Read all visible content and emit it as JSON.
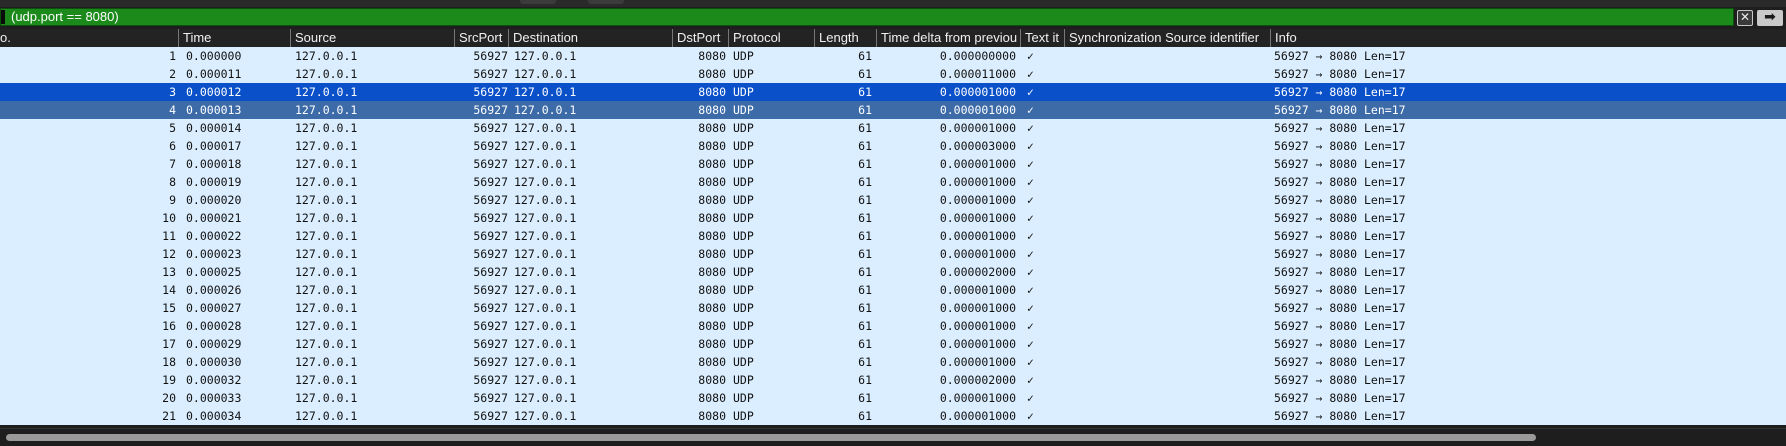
{
  "filter": {
    "value": "(udp.port == 8080)",
    "clear_icon": "✕",
    "apply_icon": "➡"
  },
  "columns": [
    "o.",
    "Time",
    "Source",
    "SrcPort",
    "Destination",
    "DstPort",
    "Protocol",
    "Length",
    "Time delta from previou",
    "Text it",
    "Synchronization Source identifier",
    "Info"
  ],
  "check": "✓",
  "selection": {
    "selected_row": 3,
    "secondary_row": 4
  },
  "rows": [
    {
      "no": "1",
      "time": "0.000000",
      "src": "127.0.0.1",
      "sport": "56927",
      "dst": "127.0.0.1",
      "dport": "8080",
      "proto": "UDP",
      "len": "61",
      "delta": "0.000000000",
      "info": "56927 → 8080 Len=17"
    },
    {
      "no": "2",
      "time": "0.000011",
      "src": "127.0.0.1",
      "sport": "56927",
      "dst": "127.0.0.1",
      "dport": "8080",
      "proto": "UDP",
      "len": "61",
      "delta": "0.000011000",
      "info": "56927 → 8080 Len=17"
    },
    {
      "no": "3",
      "time": "0.000012",
      "src": "127.0.0.1",
      "sport": "56927",
      "dst": "127.0.0.1",
      "dport": "8080",
      "proto": "UDP",
      "len": "61",
      "delta": "0.000001000",
      "info": "56927 → 8080 Len=17"
    },
    {
      "no": "4",
      "time": "0.000013",
      "src": "127.0.0.1",
      "sport": "56927",
      "dst": "127.0.0.1",
      "dport": "8080",
      "proto": "UDP",
      "len": "61",
      "delta": "0.000001000",
      "info": "56927 → 8080 Len=17"
    },
    {
      "no": "5",
      "time": "0.000014",
      "src": "127.0.0.1",
      "sport": "56927",
      "dst": "127.0.0.1",
      "dport": "8080",
      "proto": "UDP",
      "len": "61",
      "delta": "0.000001000",
      "info": "56927 → 8080 Len=17"
    },
    {
      "no": "6",
      "time": "0.000017",
      "src": "127.0.0.1",
      "sport": "56927",
      "dst": "127.0.0.1",
      "dport": "8080",
      "proto": "UDP",
      "len": "61",
      "delta": "0.000003000",
      "info": "56927 → 8080 Len=17"
    },
    {
      "no": "7",
      "time": "0.000018",
      "src": "127.0.0.1",
      "sport": "56927",
      "dst": "127.0.0.1",
      "dport": "8080",
      "proto": "UDP",
      "len": "61",
      "delta": "0.000001000",
      "info": "56927 → 8080 Len=17"
    },
    {
      "no": "8",
      "time": "0.000019",
      "src": "127.0.0.1",
      "sport": "56927",
      "dst": "127.0.0.1",
      "dport": "8080",
      "proto": "UDP",
      "len": "61",
      "delta": "0.000001000",
      "info": "56927 → 8080 Len=17"
    },
    {
      "no": "9",
      "time": "0.000020",
      "src": "127.0.0.1",
      "sport": "56927",
      "dst": "127.0.0.1",
      "dport": "8080",
      "proto": "UDP",
      "len": "61",
      "delta": "0.000001000",
      "info": "56927 → 8080 Len=17"
    },
    {
      "no": "10",
      "time": "0.000021",
      "src": "127.0.0.1",
      "sport": "56927",
      "dst": "127.0.0.1",
      "dport": "8080",
      "proto": "UDP",
      "len": "61",
      "delta": "0.000001000",
      "info": "56927 → 8080 Len=17"
    },
    {
      "no": "11",
      "time": "0.000022",
      "src": "127.0.0.1",
      "sport": "56927",
      "dst": "127.0.0.1",
      "dport": "8080",
      "proto": "UDP",
      "len": "61",
      "delta": "0.000001000",
      "info": "56927 → 8080 Len=17"
    },
    {
      "no": "12",
      "time": "0.000023",
      "src": "127.0.0.1",
      "sport": "56927",
      "dst": "127.0.0.1",
      "dport": "8080",
      "proto": "UDP",
      "len": "61",
      "delta": "0.000001000",
      "info": "56927 → 8080 Len=17"
    },
    {
      "no": "13",
      "time": "0.000025",
      "src": "127.0.0.1",
      "sport": "56927",
      "dst": "127.0.0.1",
      "dport": "8080",
      "proto": "UDP",
      "len": "61",
      "delta": "0.000002000",
      "info": "56927 → 8080 Len=17"
    },
    {
      "no": "14",
      "time": "0.000026",
      "src": "127.0.0.1",
      "sport": "56927",
      "dst": "127.0.0.1",
      "dport": "8080",
      "proto": "UDP",
      "len": "61",
      "delta": "0.000001000",
      "info": "56927 → 8080 Len=17"
    },
    {
      "no": "15",
      "time": "0.000027",
      "src": "127.0.0.1",
      "sport": "56927",
      "dst": "127.0.0.1",
      "dport": "8080",
      "proto": "UDP",
      "len": "61",
      "delta": "0.000001000",
      "info": "56927 → 8080 Len=17"
    },
    {
      "no": "16",
      "time": "0.000028",
      "src": "127.0.0.1",
      "sport": "56927",
      "dst": "127.0.0.1",
      "dport": "8080",
      "proto": "UDP",
      "len": "61",
      "delta": "0.000001000",
      "info": "56927 → 8080 Len=17"
    },
    {
      "no": "17",
      "time": "0.000029",
      "src": "127.0.0.1",
      "sport": "56927",
      "dst": "127.0.0.1",
      "dport": "8080",
      "proto": "UDP",
      "len": "61",
      "delta": "0.000001000",
      "info": "56927 → 8080 Len=17"
    },
    {
      "no": "18",
      "time": "0.000030",
      "src": "127.0.0.1",
      "sport": "56927",
      "dst": "127.0.0.1",
      "dport": "8080",
      "proto": "UDP",
      "len": "61",
      "delta": "0.000001000",
      "info": "56927 → 8080 Len=17"
    },
    {
      "no": "19",
      "time": "0.000032",
      "src": "127.0.0.1",
      "sport": "56927",
      "dst": "127.0.0.1",
      "dport": "8080",
      "proto": "UDP",
      "len": "61",
      "delta": "0.000002000",
      "info": "56927 → 8080 Len=17"
    },
    {
      "no": "20",
      "time": "0.000033",
      "src": "127.0.0.1",
      "sport": "56927",
      "dst": "127.0.0.1",
      "dport": "8080",
      "proto": "UDP",
      "len": "61",
      "delta": "0.000001000",
      "info": "56927 → 8080 Len=17"
    },
    {
      "no": "21",
      "time": "0.000034",
      "src": "127.0.0.1",
      "sport": "56927",
      "dst": "127.0.0.1",
      "dport": "8080",
      "proto": "UDP",
      "len": "61",
      "delta": "0.000001000",
      "info": "56927 → 8080 Len=17"
    }
  ]
}
